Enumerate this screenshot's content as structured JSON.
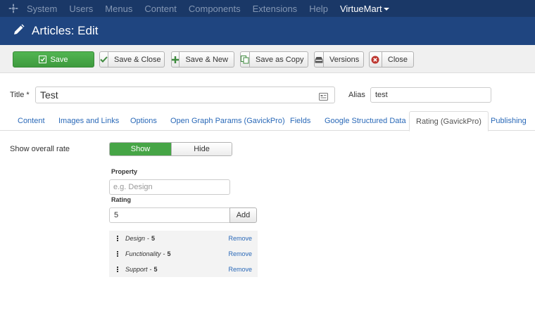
{
  "topnav": {
    "items": [
      "System",
      "Users",
      "Menus",
      "Content",
      "Components",
      "Extensions",
      "Help",
      "VirtueMart"
    ]
  },
  "header": {
    "title": "Articles: Edit"
  },
  "toolbar": {
    "save": "Save",
    "save_close": "Save & Close",
    "save_new": "Save & New",
    "save_copy": "Save as Copy",
    "versions": "Versions",
    "close": "Close"
  },
  "form": {
    "title_label": "Title *",
    "title_value": "Test",
    "alias_label": "Alias",
    "alias_value": "test"
  },
  "tabs": [
    "Content",
    "Images and Links",
    "Options",
    "Open Graph Params (GavickPro)",
    "Fields",
    "Google Structured Data",
    "Rating (GavickPro)",
    "Publishing"
  ],
  "rating": {
    "show_label": "Show overall rate",
    "show": "Show",
    "hide": "Hide",
    "property_label": "Property",
    "property_placeholder": "e.g. Design",
    "rating_label": "Rating",
    "rating_value": "5",
    "add": "Add",
    "items": [
      {
        "name": "Design",
        "separator": "-",
        "score": "5",
        "remove": "Remove"
      },
      {
        "name": "Functionality",
        "separator": "-",
        "score": "5",
        "remove": "Remove"
      },
      {
        "name": "Support",
        "separator": "-",
        "score": "5",
        "remove": "Remove"
      }
    ]
  },
  "colors": {
    "topnav_bg": "#1a3867",
    "header_bg": "#1f4580",
    "save_green": "#46a546",
    "link_blue": "#2a69b8"
  }
}
